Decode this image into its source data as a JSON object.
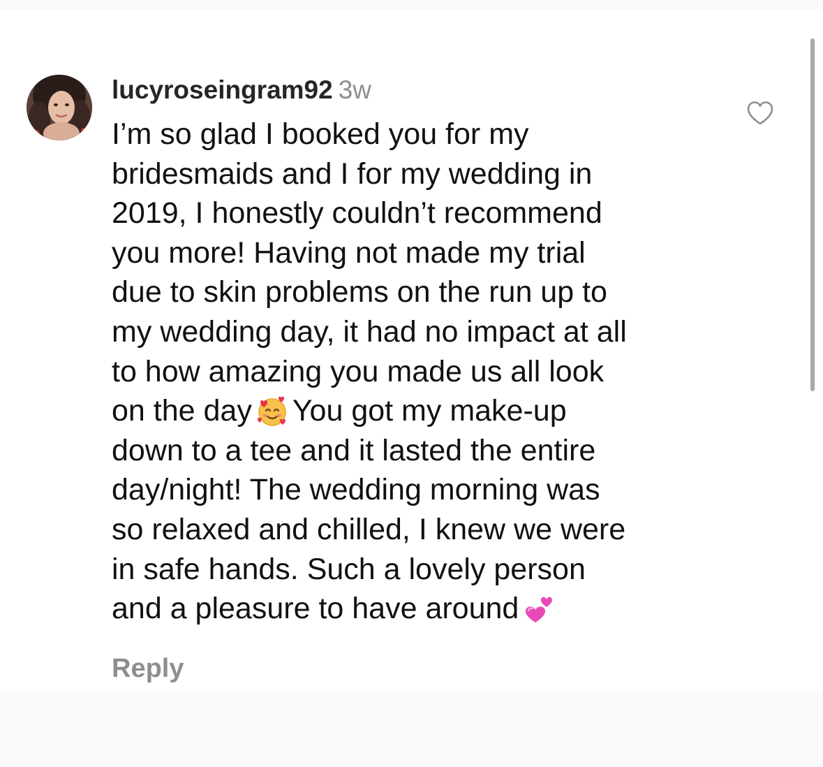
{
  "comment": {
    "username": "lucyroseingram92",
    "time_ago": "3w",
    "lines": [
      "I’m so glad I booked you for my",
      "bridesmaids and I for my wedding in",
      "2019, I honestly couldn’t recommend",
      "you more! Having not made my trial",
      "due to skin problems on the run up to",
      "my wedding day, it had no impact at all",
      "to how amazing you made us all look",
      "on the day",
      "You got my make-up",
      "down to a tee and it lasted the entire",
      "day/night! The wedding morning was",
      "so relaxed and chilled, I knew we were",
      "in safe hands. Such a lovely person",
      "and a pleasure to have around"
    ],
    "emojis": [
      "smiling-face-with-hearts-emoji",
      "two-hearts-emoji"
    ],
    "reply_label": "Reply"
  },
  "icons": {
    "like": "heart-outline-icon"
  },
  "colors": {
    "username": "#262626",
    "secondary_text": "#8e8e8e",
    "body_text": "#111111",
    "background": "#ffffff"
  }
}
